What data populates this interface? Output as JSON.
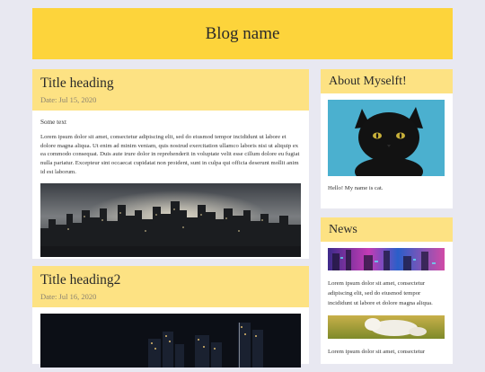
{
  "blog": {
    "name": "Blog name"
  },
  "posts": [
    {
      "title": "Title heading",
      "date": "Date: Jul 15, 2020",
      "subtitle": "Some text",
      "text": "Lorem ipsum dolor sit amet, consectetur adipiscing elit, sed do eiusmod tempor incididunt ut labore et dolore magna aliqua. Ut enim ad minim veniam, quis nostrud exercitation ullamco laboris nisi ut aliquip ex ea commodo consequat. Duis aute irure dolor in reprehenderit in voluptate velit esse cillum dolore eu fugiat nulla pariatur. Excepteur sint occaecat cupidatat non proident, sunt in culpa qui officia deserunt mollit anim id est laborum."
    },
    {
      "title": "Title heading2",
      "date": "Date: Jul 16, 2020"
    }
  ],
  "about": {
    "heading": "About Myselft!",
    "text": "Hello! My name is cat."
  },
  "news": {
    "heading": "News",
    "items": [
      {
        "text": "Lorem ipsum dolor sit amet, consectetur adipiscing elit, sed do eiusmod tempor incididunt ut labore et dolore magna aliqua."
      },
      {
        "text": "Lorem ipsum dolor sit amet, consectetur"
      }
    ]
  },
  "colors": {
    "header_bg": "#fdd43b",
    "card_head_bg": "#fde283",
    "page_bg": "#e8e8f1"
  }
}
